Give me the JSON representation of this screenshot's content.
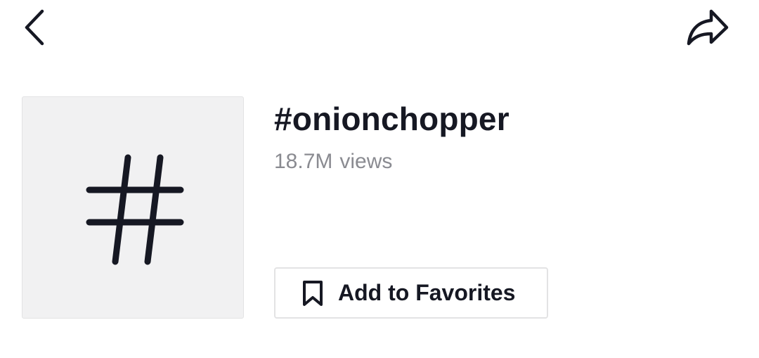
{
  "header": {
    "back_icon": "chevron-left-icon",
    "share_icon": "share-arrow-icon"
  },
  "hashtag": {
    "thumbnail_icon": "hashtag-icon",
    "title": "#onionchopper",
    "views_count": "18.7M",
    "views_label": "views"
  },
  "favorites_button": {
    "icon": "bookmark-icon",
    "label": "Add to Favorites"
  },
  "colors": {
    "text_primary": "#161823",
    "text_secondary": "#8a8b91",
    "thumbnail_bg": "#f1f1f2",
    "border": "#e3e3e4"
  }
}
